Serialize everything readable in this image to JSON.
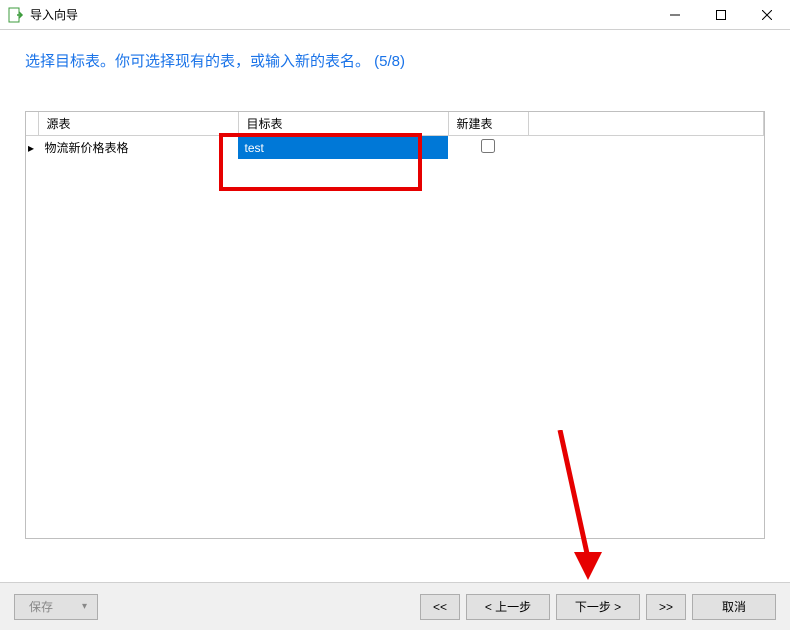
{
  "window": {
    "title": "导入向导"
  },
  "instruction": "选择目标表。你可选择现有的表，或输入新的表名。 (5/8)",
  "table": {
    "headers": {
      "source": "源表",
      "target": "目标表",
      "new": "新建表"
    },
    "row": {
      "source": "物流新价格表格",
      "target": "test",
      "new_checked": false
    }
  },
  "footer": {
    "save": "保存",
    "first": "<<",
    "prev": "< 上一步",
    "next": "下一步 >",
    "last": ">>",
    "cancel": "取消"
  }
}
